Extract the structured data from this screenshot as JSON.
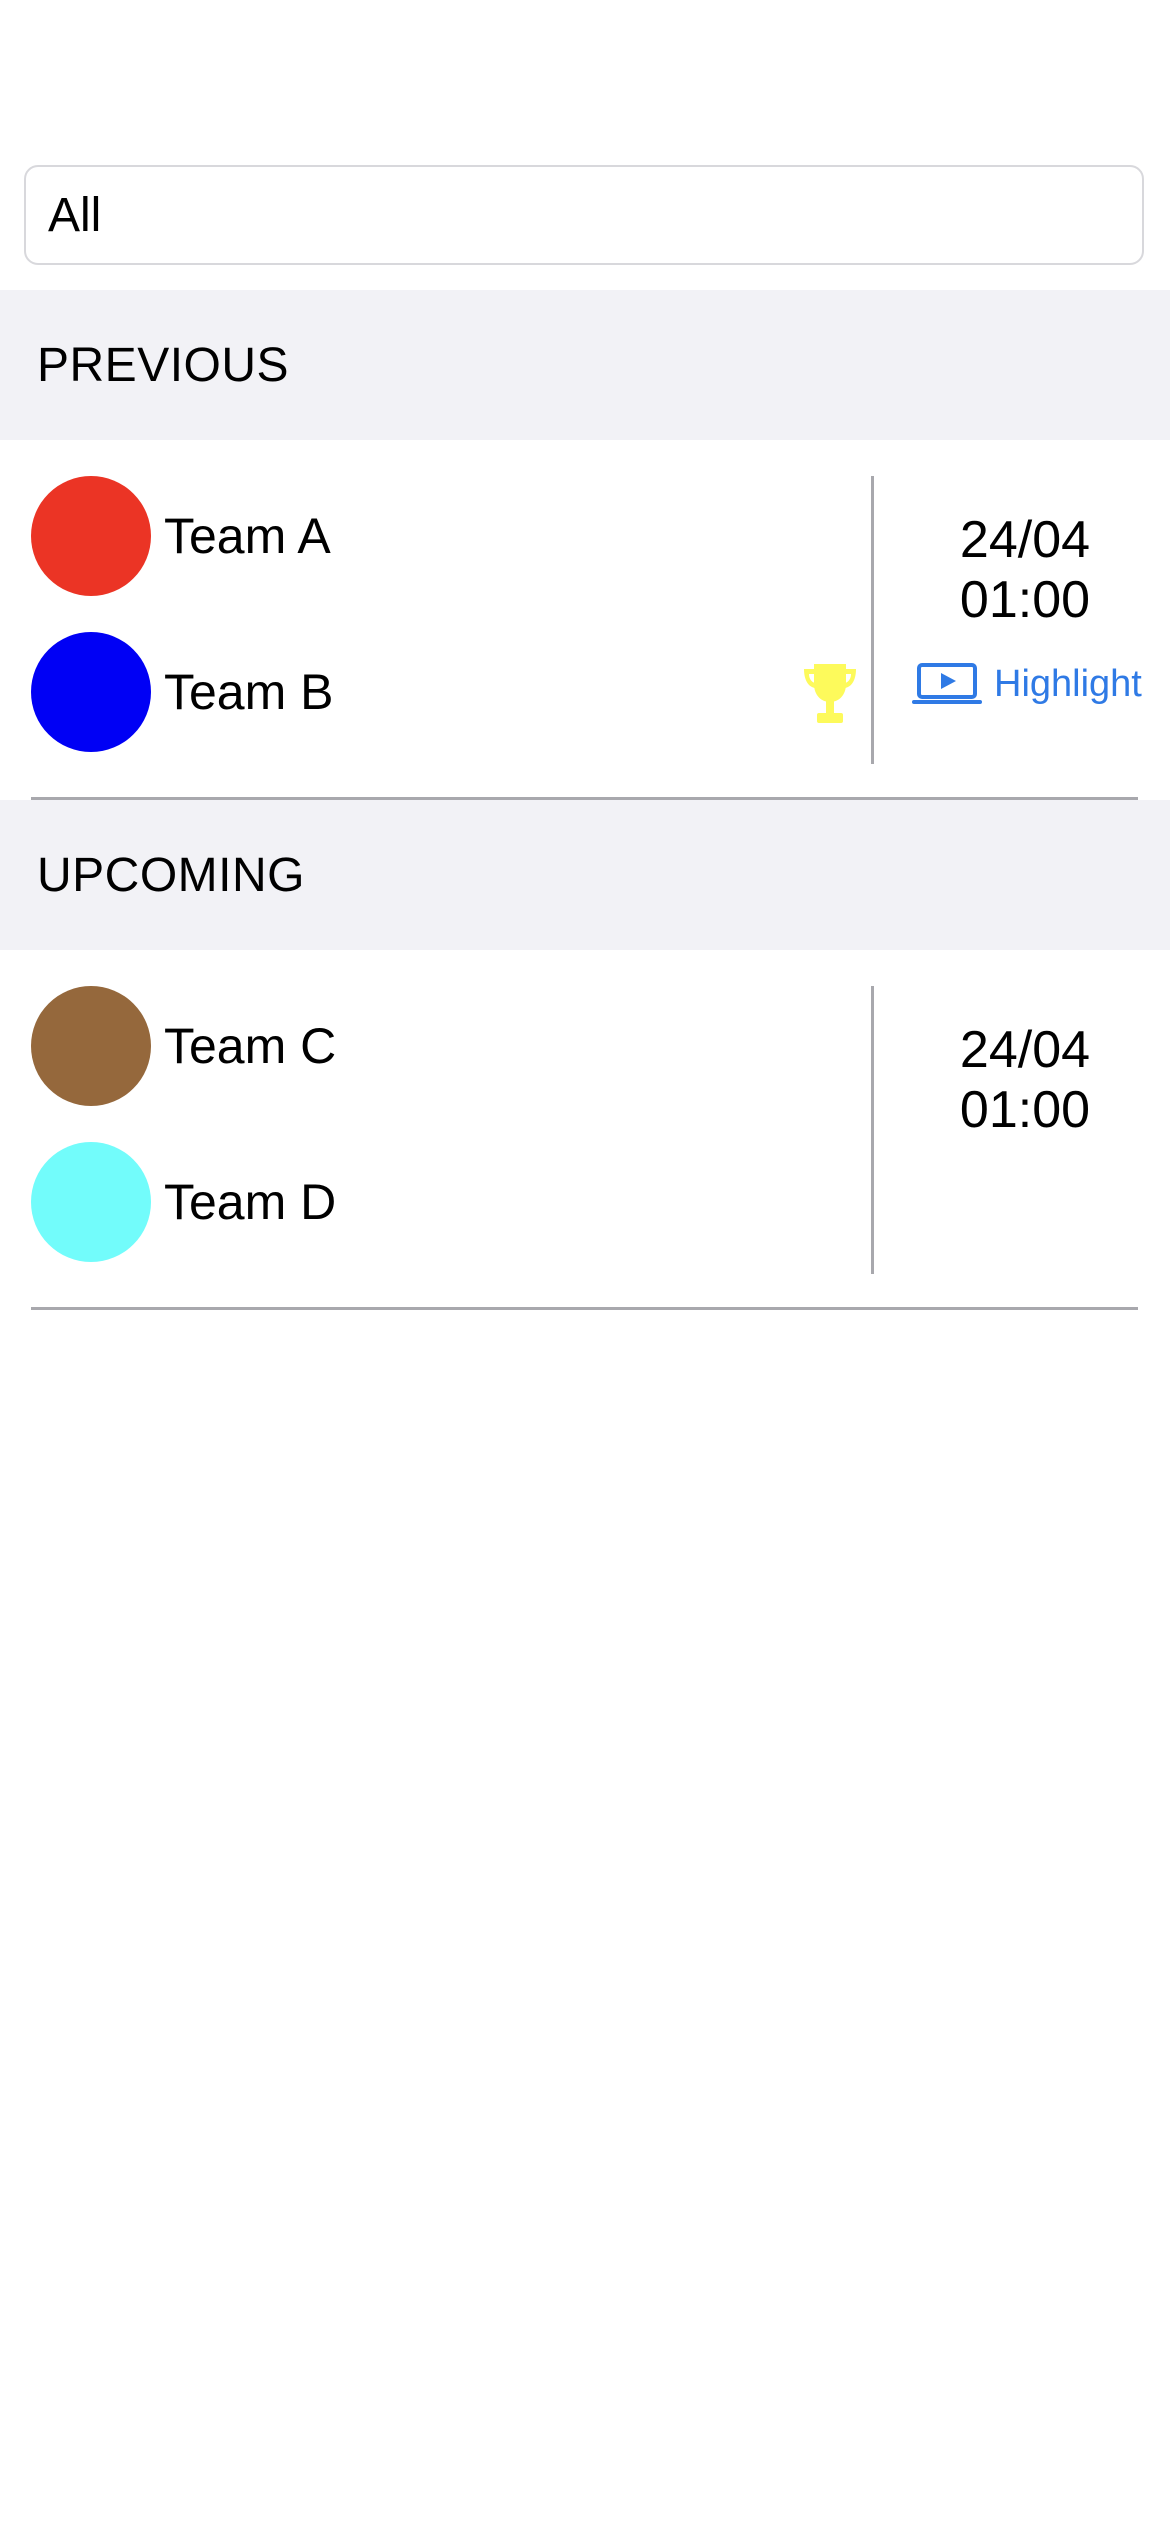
{
  "filter": {
    "selected": "All"
  },
  "sections": {
    "previous": {
      "title": "PREVIOUS",
      "match": {
        "team_a": {
          "name": "Team A",
          "color": "#eb3425"
        },
        "team_b": {
          "name": "Team B",
          "color": "#0000f5"
        },
        "winner": "team_b",
        "trophy_color": "#fdfa5b",
        "date": "24/04",
        "time": "01:00",
        "highlight_label": "Highlight",
        "highlight_icon": "play-screen-icon",
        "highlight_color": "#2f7ae5"
      }
    },
    "upcoming": {
      "title": "UPCOMING",
      "match": {
        "team_c": {
          "name": "Team C",
          "color": "#95683c"
        },
        "team_d": {
          "name": "Team D",
          "color": "#72fcfb"
        },
        "date": "24/04",
        "time": "01:00"
      }
    }
  }
}
